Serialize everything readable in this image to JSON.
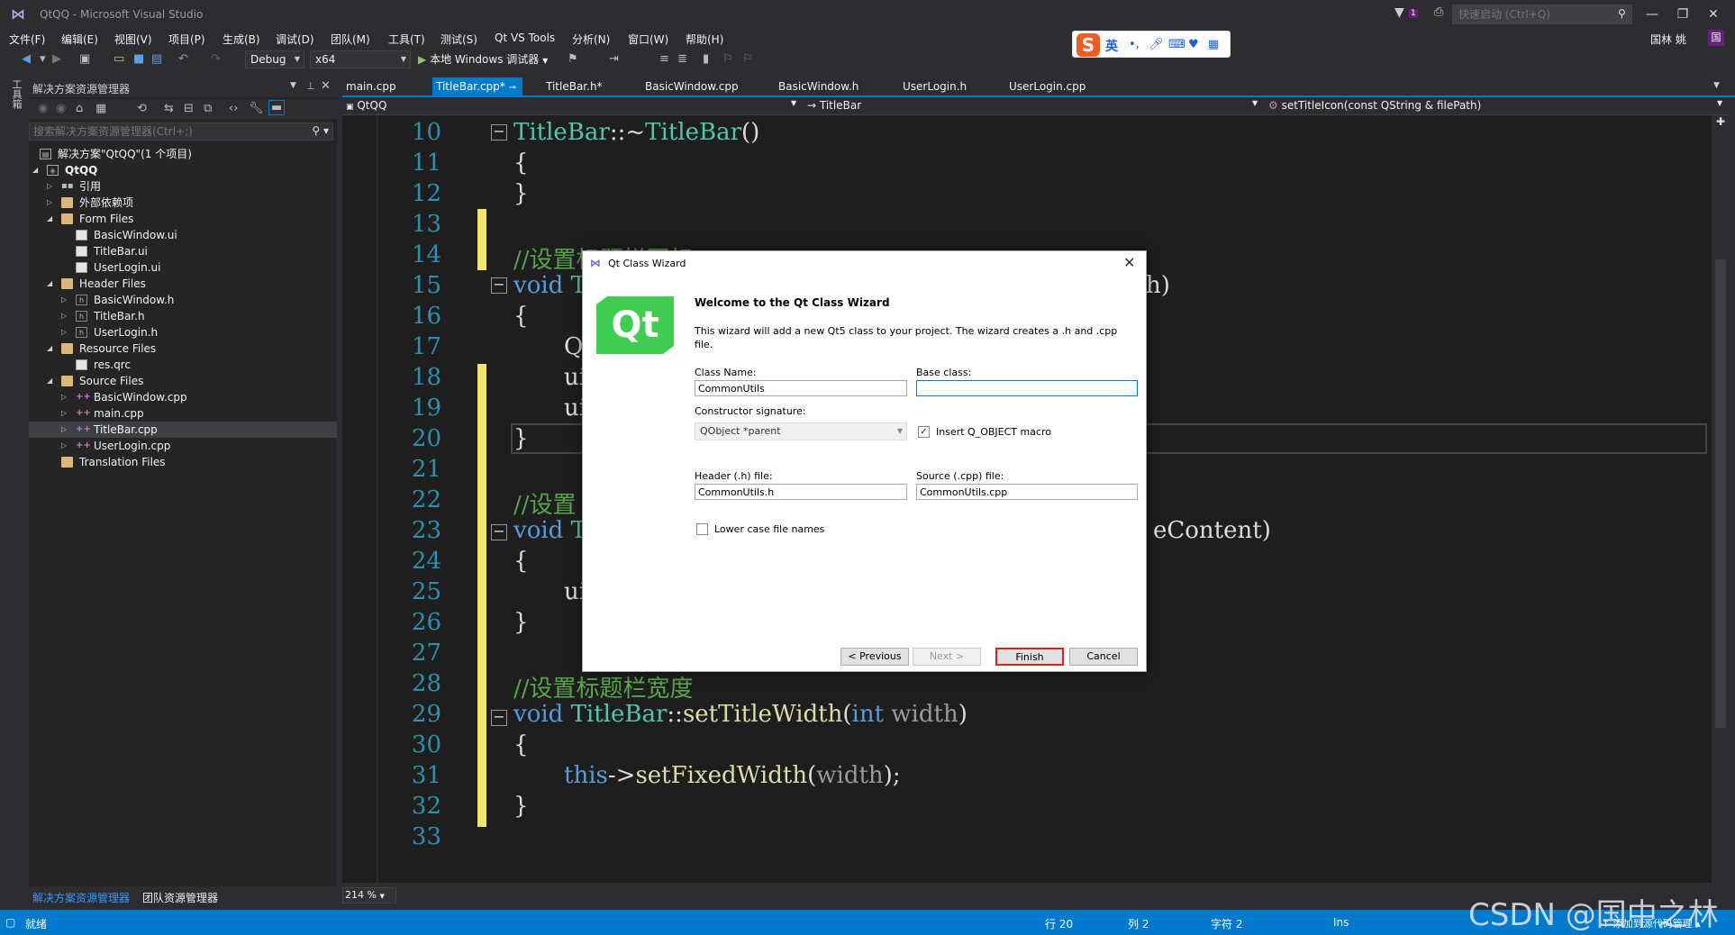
{
  "window": {
    "title": "QtQQ - Microsoft Visual Studio",
    "quick_launch_placeholder": "快速启动 (Ctrl+Q)",
    "notification_count": "1",
    "minimize": "—",
    "restore": "❐",
    "close": "✕",
    "user": "国林 姚",
    "user_badge": "国"
  },
  "menu": [
    "文件(F)",
    "编辑(E)",
    "视图(V)",
    "项目(P)",
    "生成(B)",
    "调试(D)",
    "团队(M)",
    "工具(T)",
    "测试(S)",
    "Qt VS Tools",
    "分析(N)",
    "窗口(W)",
    "帮助(H)"
  ],
  "ime": {
    "logo": "S",
    "lang": "英"
  },
  "toolbar": {
    "config": "Debug",
    "platform": "x64",
    "run_label": "本地 Windows 调试器"
  },
  "left_strip": "工具箱",
  "solution_explorer": {
    "title": "解决方案资源管理器",
    "search_placeholder": "搜索解决方案资源管理器(Ctrl+;)",
    "items": [
      {
        "label": "解决方案\"QtQQ\"(1 个项目)"
      },
      {
        "label": "QtQQ"
      },
      {
        "label": "引用"
      },
      {
        "label": "外部依赖项"
      },
      {
        "label": "Form Files"
      },
      {
        "label": "BasicWindow.ui"
      },
      {
        "label": "TitleBar.ui"
      },
      {
        "label": "UserLogin.ui"
      },
      {
        "label": "Header Files"
      },
      {
        "label": "BasicWindow.h"
      },
      {
        "label": "TitleBar.h"
      },
      {
        "label": "UserLogin.h"
      },
      {
        "label": "Resource Files"
      },
      {
        "label": "res.qrc"
      },
      {
        "label": "Source Files"
      },
      {
        "label": "BasicWindow.cpp"
      },
      {
        "label": "main.cpp"
      },
      {
        "label": "TitleBar.cpp"
      },
      {
        "label": "UserLogin.cpp"
      },
      {
        "label": "Translation Files"
      }
    ],
    "bottom_tabs": [
      "解决方案资源管理器",
      "团队资源管理器"
    ]
  },
  "tabs": [
    "main.cpp",
    "TitleBar.cpp*",
    "TitleBar.h*",
    "BasicWindow.cpp",
    "BasicWindow.h",
    "UserLogin.h",
    "UserLogin.cpp"
  ],
  "navbar": {
    "project": "QtQQ",
    "class": "TitleBar",
    "member": "setTitleIcon(const QString & filePath)"
  },
  "editor": {
    "zoom": "214 %",
    "lines": [
      "10",
      "11",
      "12",
      "13",
      "14",
      "15",
      "16",
      "17",
      "18",
      "19",
      "20",
      "21",
      "22",
      "23",
      "24",
      "25",
      "26",
      "27",
      "28",
      "29",
      "30",
      "31",
      "32",
      "33"
    ],
    "code": {
      "l10a": "TitleBar",
      "l10b": "::~",
      "l10c": "TitleBar",
      "l10d": "()",
      "l11": "{",
      "l12": "}",
      "l14": "//设置标题栏图标",
      "l15a": "void",
      "l15b": "T",
      "l15c": "h)",
      "l16": "{",
      "l17": "QF",
      "l18": "ui",
      "l19": "ui",
      "l20": "}",
      "l22": "//设置",
      "l23a": "void",
      "l23b": "T",
      "l23c": "eContent)",
      "l24": "{",
      "l25": "ui",
      "l26": "}",
      "l28": "//设置标题栏宽度",
      "l29a": "void",
      "l29b": "TitleBar",
      "l29c": "::",
      "l29d": "setTitleWidth",
      "l29e": "(",
      "l29f": "int",
      "l29g": "width",
      "l29h": ")",
      "l30": "{",
      "l31a": "this",
      "l31b": "->",
      "l31c": "setFixedWidth",
      "l31d": "(",
      "l31e": "width",
      "l31f": ");",
      "l32": "}"
    }
  },
  "dialog": {
    "title": "Qt Class Wizard",
    "logo": "Qt",
    "heading": "Welcome to the Qt Class Wizard",
    "description": "This wizard will add a new Qt5 class to your project. The wizard creates a .h and .cpp file.",
    "class_name_label": "Class Name:",
    "class_name_value": "CommonUtils",
    "base_class_label": "Base class:",
    "base_class_value": "",
    "ctor_label": "Constructor signature:",
    "ctor_value": "QObject *parent",
    "qobject_macro_label": "Insert Q_OBJECT macro",
    "qobject_macro_checked": true,
    "header_label": "Header (.h) file:",
    "header_value": "CommonUtils.h",
    "source_label": "Source (.cpp) file:",
    "source_value": "CommonUtils.cpp",
    "lowercase_label": "Lower case file names",
    "lowercase_checked": false,
    "btn_previous": "< Previous",
    "btn_next": "Next >",
    "btn_finish": "Finish",
    "btn_cancel": "Cancel"
  },
  "status": {
    "ready": "就绪",
    "line": "行 20",
    "col": "列 2",
    "char": "字符 2",
    "ins": "Ins",
    "source_control": "↑ 添加到源代码管理 ▴"
  },
  "watermark": "CSDN @国中之林"
}
